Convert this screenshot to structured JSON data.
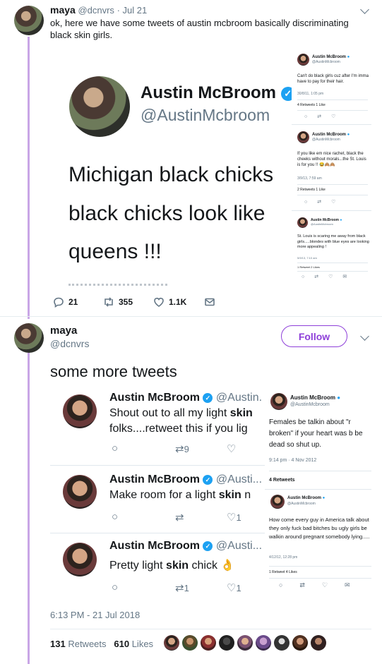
{
  "tweet1": {
    "name": "maya",
    "handle": "@dcnvrs",
    "sep": "·",
    "date": "Jul 21",
    "text": "ok, here we have some tweets of austin mcbroom basically discriminating black skin girls.",
    "image": {
      "main": {
        "name": "Austin McBroom",
        "handle": "@AustinMcbroom",
        "line1": "Michigan black chicks",
        "line2": "black chicks look like",
        "line3": "queens !!!"
      },
      "side1": {
        "name": "Austin McBroom",
        "handle": "@AustinMcbroom",
        "text": "Can't do black girls cuz after I'm imma have to pay for their hair.",
        "date": "30/8/11, 1:05 pm",
        "stats": "4 Retweets  1 Like"
      },
      "side2": {
        "name": "Austin McBroom",
        "handle": "@AustinMcbroom",
        "text": "If you like em nice rachet, black the cheeks without morals...the St. Louis is for you !! 😂🙈🙈",
        "date": "3/9/13, 7:59 am",
        "stats": "2 Retweets  1 Like"
      },
      "side3": {
        "name": "Austin McBroom",
        "handle": "@AustinMcbroom",
        "text": "St. Louis is scaring me away from black girls.....blondes with blue eyes are looking more appealing !",
        "date": "5/9/13, 7:10 am",
        "stats": "1 Retweet  2 Likes"
      }
    },
    "replies": "21",
    "retweets": "355",
    "likes": "1.1K"
  },
  "tweet2": {
    "name": "maya",
    "handle": "@dcnvrs",
    "follow_label": "Follow",
    "text": "some more tweets",
    "image": {
      "row1": {
        "name": "Austin McBroom",
        "handle": "@Austin.",
        "text_a": "Shout out to all my light",
        "text_bold": "skin",
        "text_line2": "folks....retweet this if you lig",
        "retweets": "9"
      },
      "row2": {
        "name": "Austin McBroom",
        "handle": "@Austi...",
        "text_a": "Make room for a light",
        "text_bold": "skin",
        "text_b": "n",
        "likes": "1"
      },
      "row3": {
        "name": "Austin McBroom",
        "handle": "@Austi...",
        "text_a": "Pretty light",
        "text_bold": "skin",
        "text_b": "chick 👌",
        "retweets": "1",
        "likes": "1"
      },
      "right1": {
        "name": "Austin McBroom",
        "handle": "@AustinMcbroom",
        "text": "Females be talkin about \"r broken\" if your heart was b be dead so shut up.",
        "date": "9:14 pm · 4 Nov 2012",
        "stats": "4 Retweets"
      },
      "right2": {
        "name": "Austin McBroom",
        "handle": "@AustinMcbroom",
        "text": "How come every guy in America talk about they only fuck bad bitches bu ugly girls be walkin around pregnant somebody lying.....",
        "date": "4/12/12, 12:28 pm",
        "stats": "1 Retweet  4 Likes"
      }
    },
    "timestamp": "6:13 PM - 21 Jul 2018",
    "retweet_count": "131",
    "retweet_label": "Retweets",
    "like_count": "610",
    "like_label": "Likes"
  },
  "colors": {
    "accent": "#8e3fd9",
    "thread": "#c9a6e6",
    "verified": "#1da1f2"
  }
}
